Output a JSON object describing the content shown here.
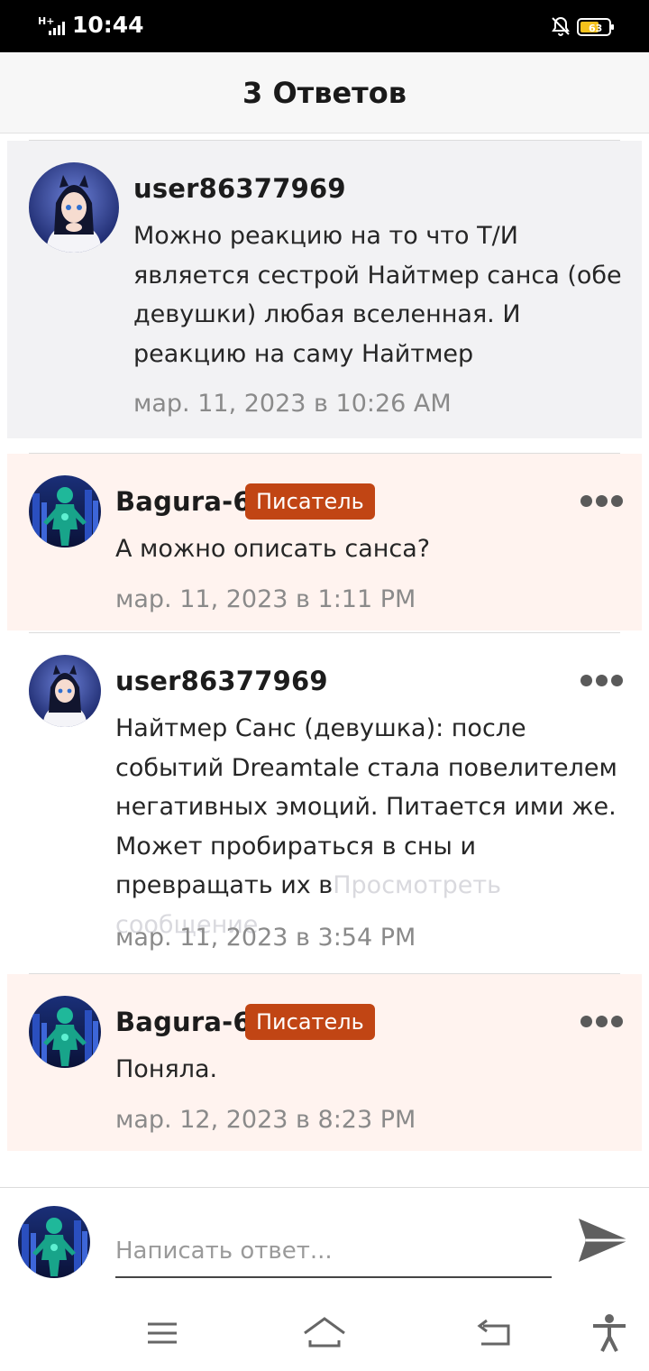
{
  "status_bar": {
    "network": "H+",
    "time": "10:44",
    "battery_level": "63"
  },
  "header": {
    "title": "3 Ответов"
  },
  "comments": [
    {
      "username": "user86377969",
      "text": "Можно реакцию на то что Т/И является сестрой Найтмер санса (обе девушки) любая вселенная. И реакцию на саму Найтмер",
      "date": "мар. 11, 2023 в 10:26 AM"
    },
    {
      "username": "Bagura-6",
      "badge": "Писатель",
      "text": "А можно описать санса?",
      "date": "мар. 11, 2023 в 1:11 PM"
    },
    {
      "username": "user86377969",
      "text": "Найтмер Санс (девушка): после событий Dreamtale стала повелителем негативных эмоций. Питается ими же. Может пробираться в сны и превращать их в",
      "more_link": "Просмотреть сообщение",
      "date": "мар. 11, 2023 в 3:54 PM"
    },
    {
      "username": "Bagura-6",
      "badge": "Писатель",
      "text": "Поняла.",
      "date": "мар. 12, 2023 в 8:23 PM"
    }
  ],
  "reply": {
    "placeholder": "Написать ответ..."
  },
  "icons": {
    "send": "send-arrow-icon",
    "more": "more-dots-icon",
    "nav": [
      "menu-icon",
      "home-icon",
      "back-icon",
      "accessibility-icon"
    ]
  },
  "colors": {
    "badge": "#c14514",
    "original_bg": "#f2f2f4",
    "writer_bg": "#fff3ef"
  }
}
